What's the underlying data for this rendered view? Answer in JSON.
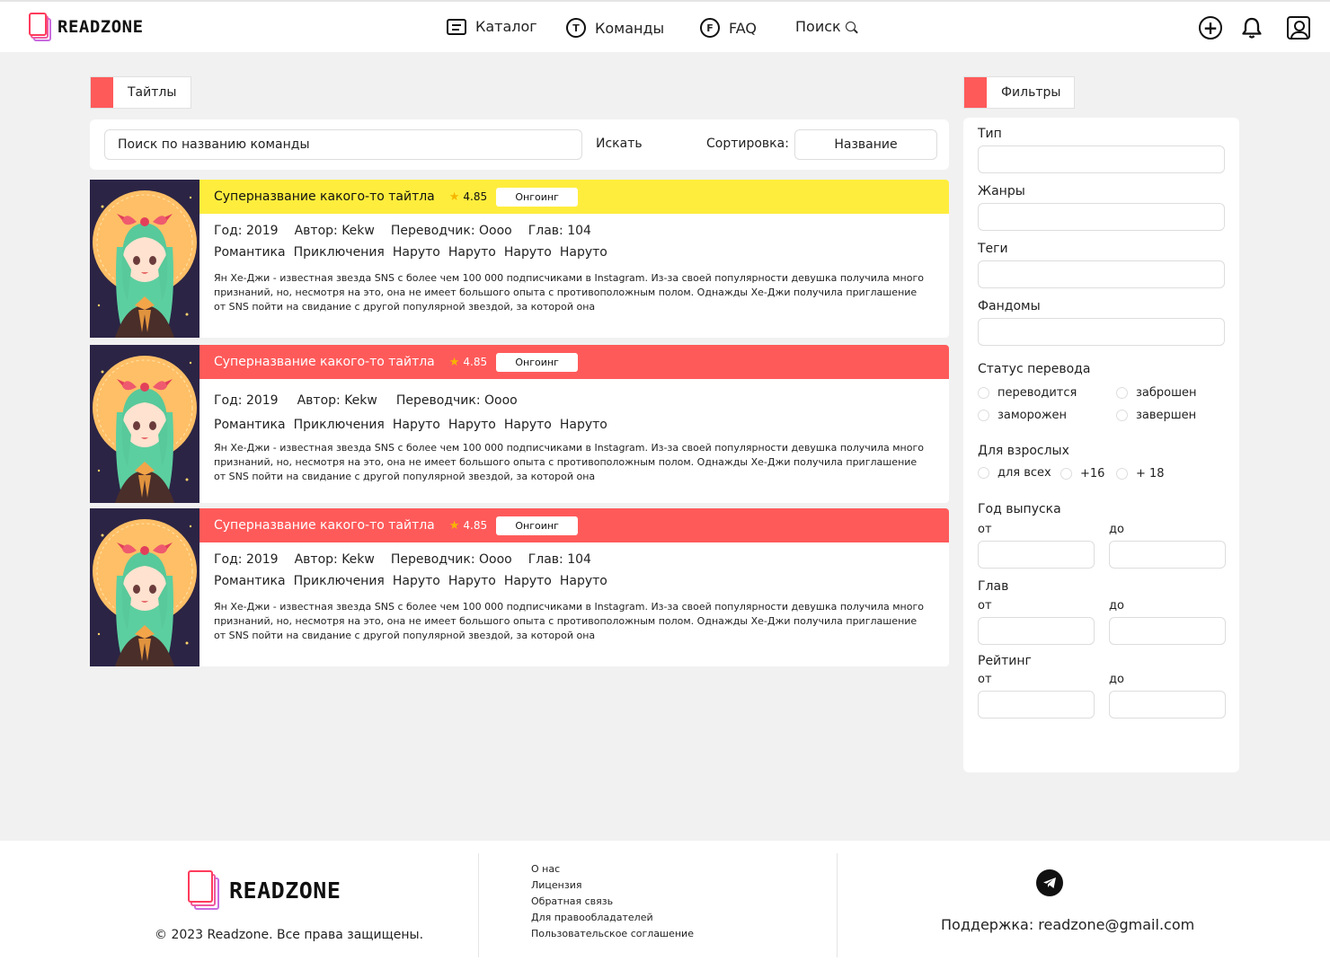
{
  "header": {
    "logo_text": "READZONE",
    "nav": [
      {
        "label": "Каталог",
        "icon": "catalog-icon"
      },
      {
        "label": "Команды",
        "icon": "teams-icon",
        "badge": "T"
      },
      {
        "label": "FAQ",
        "icon": "faq-icon",
        "badge": "F"
      },
      {
        "label": "Поиск",
        "icon": "search-icon"
      }
    ],
    "actions": [
      "add-icon",
      "bell-icon",
      "profile-icon"
    ]
  },
  "titles_tab": "Тайтлы",
  "filters_tab": "Фильтры",
  "search": {
    "value": "Поиск по названию команды",
    "go_label": "Искать",
    "sort_label": "Сортировка:",
    "sort_value": "Название"
  },
  "cards": [
    {
      "title": "Супер­название какого-то тайтла",
      "rating": "4.85",
      "status": "Онгоинг",
      "year": "Год: 2019",
      "author": "Автор: Kekw",
      "translator": "Переводчик: Оооо",
      "chapters": "Глав: 104",
      "tags": [
        "Романтика",
        "Приключения",
        "Наруто",
        "Наруто",
        "Наруто",
        "Наруто"
      ],
      "description": "Ян Хе-Джи - известная звезда SNS с более чем 100 000 подписчиками в Instagram. Из-за своей популярности девушка получила много признаний, но, несмотря на это, она не имеет большого опыта с противоположным полом. Однажды Хе-Джи получила приглашение от SNS пойти на свидание с другой популярной звездой, за которой она"
    },
    {
      "title": "Суперназвание какого-то тайтла",
      "rating": "4.85",
      "status": "Онгоинг",
      "year": "Год: 2019",
      "author": "Автор: Kekw",
      "translator": "Переводчик: Оооо",
      "tags": [
        "Романтика",
        "Приключения",
        "Наруто",
        "Наруто",
        "Наруто",
        "Наруто"
      ],
      "description": "Ян Хе-Джи - известная звезда SNS с более чем 100 000 подписчиками в Instagram. Из-за своей популярности девушка получила много признаний, но, несмотря на это, она не имеет большого опыта с противоположным полом. Однажды Хе-Джи получила приглашение от SNS пойти на свидание с другой популярной звездой, за которой она"
    },
    {
      "title": "Суперназвание какого-то тайтла",
      "rating": "4.85",
      "status": "Онгоинг",
      "year": "Год: 2019",
      "author": "Автор: Kekw",
      "translator": "Переводчик: Оооо",
      "chapters": "Глав: 104",
      "tags": [
        "Романтика",
        "Приключения",
        "Наруто",
        "Наруто",
        "Наруто",
        "Наруто"
      ],
      "description": "Ян Хе-Джи - известная звезда SNS с более чем 100 000 подписчиками в Instagram. Из-за своей популярности девушка получила много признаний, но, несмотря на это, она не имеет большого опыта с противоположным полом. Однажды Хе-Джи получила приглашение от SNS пойти на свидание с другой популярной звездой, за которой она"
    }
  ],
  "filters": {
    "type": "Тип",
    "genres": "Жанры",
    "tags": "Теги",
    "fandoms": "Фандомы",
    "status_title": "Статус перевода",
    "status_options": [
      "переводится",
      "заброшен",
      "заморожен",
      "завершен"
    ],
    "adult_title": "Для взрослых",
    "adult_options": [
      "для всех",
      "+16",
      "+ 18"
    ],
    "year_title": "Год выпуска",
    "chapters_title": "Глав",
    "rating_title": "Рейтинг",
    "from": "от",
    "to": "до"
  },
  "footer": {
    "logo_text": "READZONE",
    "copyright": "© 2023 Readzone. Все права защищены.",
    "links": [
      "О нас",
      "Лицензия",
      "Обратная связь",
      "Для правообладателей",
      "Пользовательское соглашение"
    ],
    "support": "Поддержка: readzone@gmail.com"
  },
  "colors": {
    "accent_red": "#ff5a5a",
    "accent_yellow": "#ffed3d",
    "star": "#f7b500"
  }
}
